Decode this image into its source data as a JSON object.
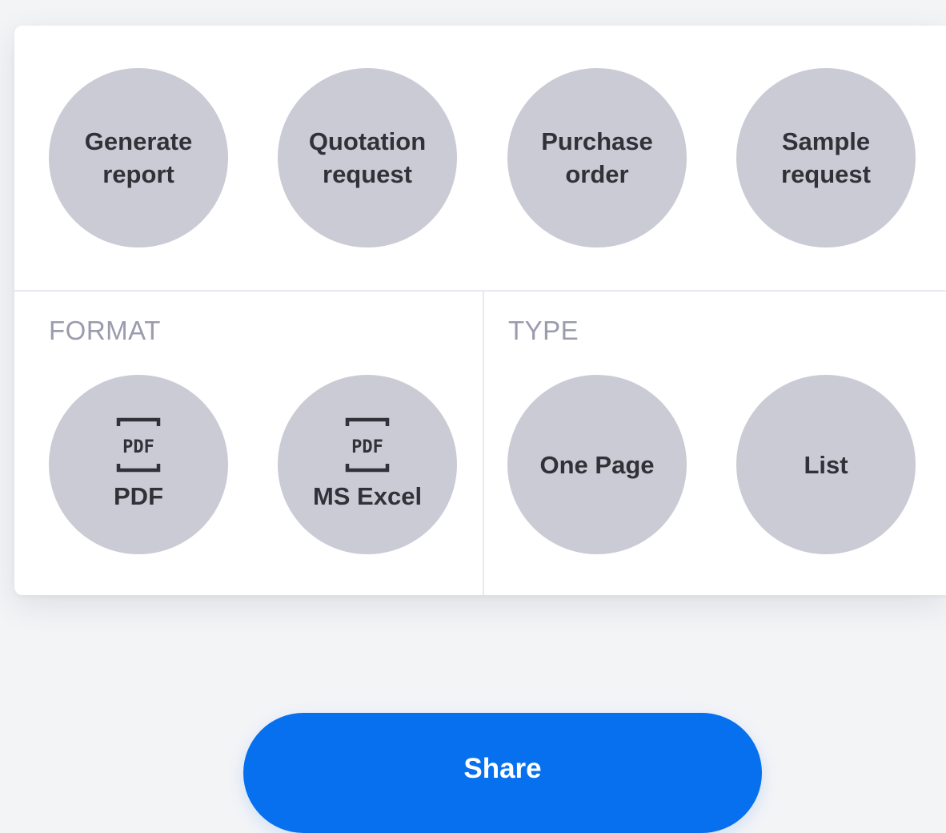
{
  "actions": [
    {
      "label": "Generate\nreport"
    },
    {
      "label": "Quotation\nrequest"
    },
    {
      "label": "Purchase\norder"
    },
    {
      "label": "Sample\nrequest"
    }
  ],
  "format": {
    "heading": "FORMAT",
    "options": [
      {
        "label": "PDF",
        "icon": "pdf-icon",
        "icon_text": "PDF"
      },
      {
        "label": "MS Excel",
        "icon": "pdf-icon",
        "icon_text": "PDF"
      }
    ]
  },
  "type": {
    "heading": "TYPE",
    "options": [
      {
        "label": "One Page"
      },
      {
        "label": "List"
      }
    ]
  },
  "share": {
    "label": "Share"
  },
  "colors": {
    "background": "#f3f4f6",
    "card": "#ffffff",
    "circle": "#cbcbd6",
    "circle_text": "#2f3236",
    "section_label": "#9b9bae",
    "accent": "#0670ef"
  }
}
